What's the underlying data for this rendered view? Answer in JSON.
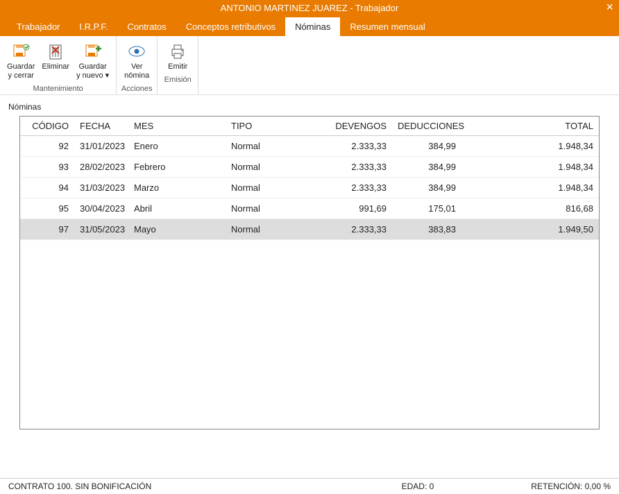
{
  "title": "ANTONIO MARTINEZ JUAREZ - Trabajador",
  "tabs": [
    {
      "label": "Trabajador"
    },
    {
      "label": "I.R.P.F."
    },
    {
      "label": "Contratos"
    },
    {
      "label": "Conceptos retributivos"
    },
    {
      "label": "Nóminas"
    },
    {
      "label": "Resumen mensual"
    }
  ],
  "active_tab": 4,
  "ribbon": {
    "groups": [
      {
        "title": "Mantenimiento",
        "items": [
          {
            "label": "Guardar\ny cerrar"
          },
          {
            "label": "Eliminar"
          },
          {
            "label": "Guardar\ny nuevo ▾"
          }
        ]
      },
      {
        "title": "Acciones",
        "items": [
          {
            "label": "Ver\nnómina"
          }
        ]
      },
      {
        "title": "Emisión",
        "items": [
          {
            "label": "Emitir"
          }
        ]
      }
    ]
  },
  "section_label": "Nóminas",
  "columns": [
    "CÓDIGO",
    "FECHA",
    "MES",
    "TIPO",
    "DEVENGOS",
    "DEDUCCIONES",
    "TOTAL"
  ],
  "rows": [
    {
      "codigo": "92",
      "fecha": "31/01/2023",
      "mes": "Enero",
      "tipo": "Normal",
      "devengos": "2.333,33",
      "deducciones": "384,99",
      "total": "1.948,34",
      "selected": false
    },
    {
      "codigo": "93",
      "fecha": "28/02/2023",
      "mes": "Febrero",
      "tipo": "Normal",
      "devengos": "2.333,33",
      "deducciones": "384,99",
      "total": "1.948,34",
      "selected": false
    },
    {
      "codigo": "94",
      "fecha": "31/03/2023",
      "mes": "Marzo",
      "tipo": "Normal",
      "devengos": "2.333,33",
      "deducciones": "384,99",
      "total": "1.948,34",
      "selected": false
    },
    {
      "codigo": "95",
      "fecha": "30/04/2023",
      "mes": "Abril",
      "tipo": "Normal",
      "devengos": "991,69",
      "deducciones": "175,01",
      "total": "816,68",
      "selected": false
    },
    {
      "codigo": "97",
      "fecha": "31/05/2023",
      "mes": "Mayo",
      "tipo": "Normal",
      "devengos": "2.333,33",
      "deducciones": "383,83",
      "total": "1.949,50",
      "selected": true
    }
  ],
  "status": {
    "left": "CONTRATO 100.  SIN BONIFICACIÓN",
    "mid": "EDAD: 0",
    "right": "RETENCIÓN: 0,00 %"
  }
}
